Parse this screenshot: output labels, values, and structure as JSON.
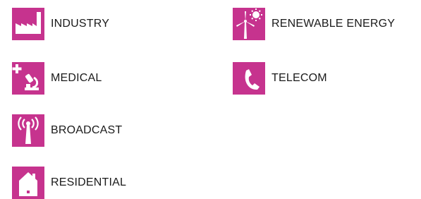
{
  "colors": {
    "tile_background": "#c6338e",
    "icon_foreground": "#ffffff",
    "label_text": "#1a1a1a"
  },
  "sectors": [
    {
      "label": "INDUSTRY",
      "icon": "factory-icon"
    },
    {
      "label": "MEDICAL",
      "icon": "medical-microscope-icon"
    },
    {
      "label": "BROADCAST",
      "icon": "broadcast-antenna-icon"
    },
    {
      "label": "RESIDENTIAL",
      "icon": "house-icon"
    },
    {
      "label": "RENEWABLE ENERGY",
      "icon": "wind-turbine-sun-icon"
    },
    {
      "label": "TELECOM",
      "icon": "telephone-handset-icon"
    }
  ]
}
